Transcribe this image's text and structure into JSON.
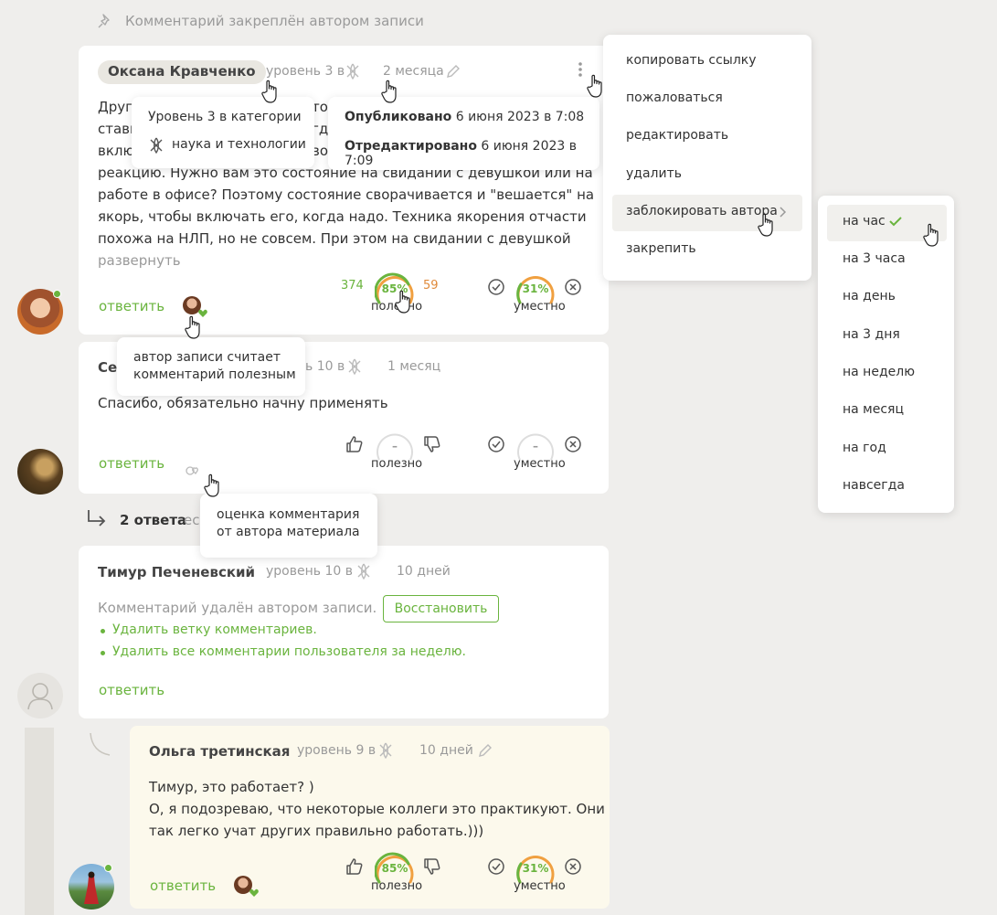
{
  "pinned_note": "Комментарий закреплён автором записи",
  "c1": {
    "author": "Оксана Кравченко",
    "level": "уровень 3 в",
    "time": "2 месяца",
    "text_lines": [
      "Друг",
      "стави",
      "вклю",
      "реакцию. Нужно вам это состояние на свидании с девушкой или на",
      "работе в офисе? Поэтому состояние сворачивается и \"вешается\" на",
      "якорь, чтобы включать его, когда надо. Техника якорения отчасти",
      "похожа на НЛП, но не совсем. При этом на свидании с девушкой"
    ],
    "partial_to": "то",
    "partial_gd": "гд",
    "partial_vo": "во",
    "expand": "развернуть",
    "reply": "ответить",
    "votes_up": "374",
    "votes_down": "59",
    "useful_pct": "85%",
    "useful_label": "полезно",
    "appropriate_pct": "31%",
    "appropriate_label": "уместно"
  },
  "tooltip_level": {
    "line1": "Уровень 3 в категории",
    "category": "наука и технологии"
  },
  "tooltip_dates": {
    "published_label": "Опубликовано",
    "published_value": "6 июня 2023 в 7:08",
    "edited_label": "Отредактировано",
    "edited_value": "6 июня 2023 в 7:09"
  },
  "tooltip_author_useful": {
    "line1": "автор записи считает",
    "line2": "комментарий полезным"
  },
  "c2": {
    "author_partial": "Сер",
    "level_partial": "ь 10 в",
    "time": "1 месяц",
    "text": "Спасибо, обязательно начну применять",
    "reply": "ответить",
    "useful_pct": "–",
    "useful_label": "полезно",
    "appropriate_pct": "–",
    "appropriate_label": "уместно"
  },
  "tooltip_rating": {
    "line1": "оценка комментария",
    "line2": "от автора материала"
  },
  "replies": {
    "count": "2 ответа",
    "partial": "ес"
  },
  "c3": {
    "author": "Тимур Печеневский",
    "level": "уровень 10 в",
    "time": "10 дней",
    "deleted_text": "Комментарий удалён автором записи.",
    "restore": "Восстановить",
    "action1": "Удалить ветку комментариев.",
    "action2": "Удалить все комментарии пользователя за неделю.",
    "reply": "ответить"
  },
  "c4": {
    "author": "Ольга третинская",
    "level": "уровень 9 в",
    "time": "10 дней",
    "text_lines": [
      "Тимур, это работает? )",
      "О, я подозреваю, что некоторые коллеги это практикуют. Они",
      "так легко учат других правильно работать.)))"
    ],
    "reply": "ответить",
    "useful_pct": "85%",
    "useful_label": "полезно",
    "appropriate_pct": "31%",
    "appropriate_label": "уместно"
  },
  "context_menu": {
    "items": [
      "копировать ссылку",
      "пожаловаться",
      "редактировать",
      "удалить",
      "заблокировать автора",
      "закрепить"
    ]
  },
  "block_submenu": {
    "items": [
      "на час",
      "на 3 часа",
      "на день",
      "на 3 дня",
      "на неделю",
      "на месяц",
      "на год",
      "навсегда"
    ],
    "selected": "на час"
  },
  "colors": {
    "green": "#6ab43e",
    "orange": "#f0a040",
    "background": "#efeeec",
    "highlight_card": "#fcf9ec"
  }
}
